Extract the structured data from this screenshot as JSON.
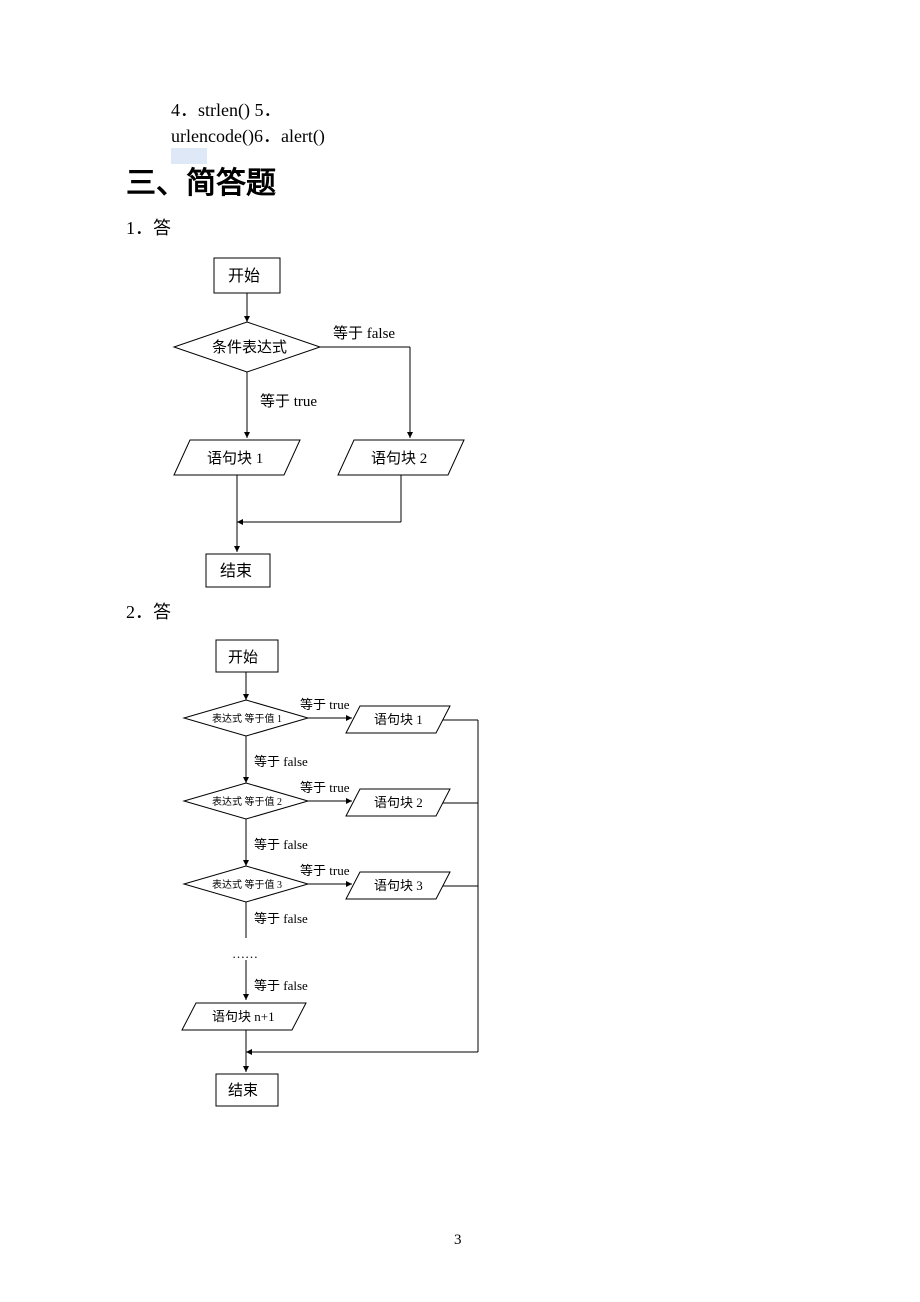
{
  "top": {
    "line1": "4．strlen() 5．",
    "line2": "urlencode()6．alert()"
  },
  "heading": "三、简答题",
  "q1_label": "1．答",
  "q2_label": "2．答",
  "fc1": {
    "start": "开始",
    "cond": "条件表达式",
    "false": "等于 false",
    "true": "等于 true",
    "block1": "语句块 1",
    "block2": "语句块 2",
    "end": "结束"
  },
  "fc2": {
    "start": "开始",
    "cond1": "表达式 等于值 1",
    "cond2": "表达式 等于值 2",
    "cond3": "表达式 等于值 3",
    "true": "等于 true",
    "false": "等于 false",
    "block1": "语句块 1",
    "block2": "语句块 2",
    "block3": "语句块 3",
    "blockn1": "语句块 n+1",
    "ellipsis": "……",
    "end": "结束"
  },
  "page_number": "3"
}
